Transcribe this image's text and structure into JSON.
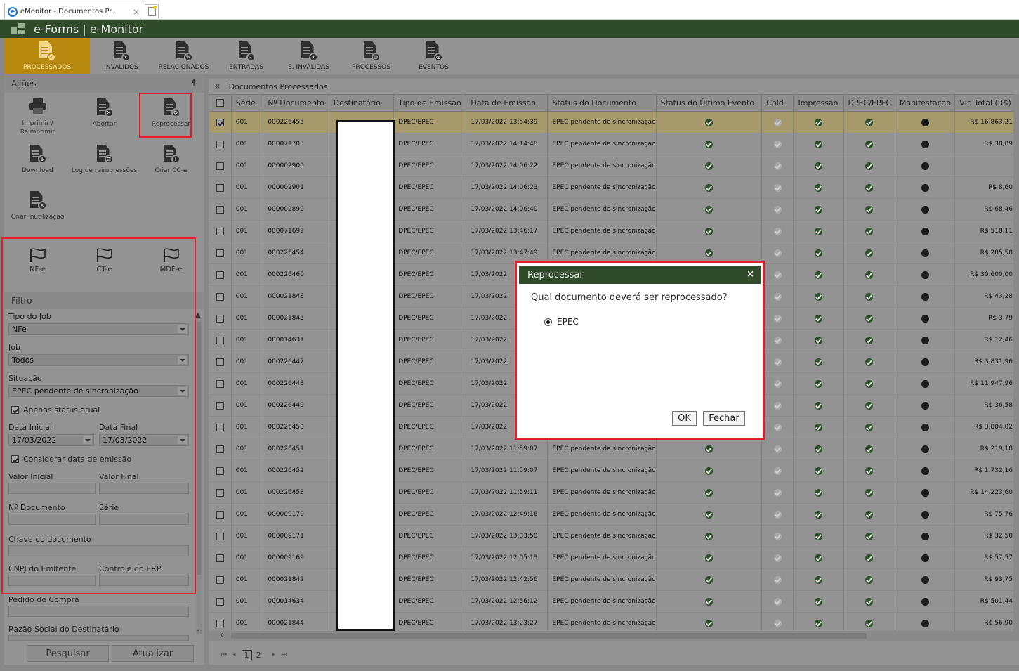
{
  "browser": {
    "tab_title": "eMonitor - Documentos Pr...",
    "tab_close": "×"
  },
  "app": {
    "title": "e-Forms | e-Monitor"
  },
  "toolbar": {
    "items": [
      {
        "label": "PROCESSADOS",
        "icon": "document-check-icon",
        "badge": "✓",
        "active": true
      },
      {
        "label": "INVÁLIDOS",
        "icon": "document-x-icon",
        "badge": "✕"
      },
      {
        "label": "RELACIONADOS",
        "icon": "document-edit-icon",
        "badge": "✎"
      },
      {
        "label": "ENTRADAS",
        "icon": "document-check-icon",
        "badge": "✓"
      },
      {
        "label": "E. INVÁLIDAS",
        "icon": "document-x-icon",
        "badge": "✕"
      },
      {
        "label": "PROCESSOS",
        "icon": "document-gear-icon",
        "badge": "⚙"
      },
      {
        "label": "EVENTOS",
        "icon": "document-event-icon",
        "badge": "⊘"
      }
    ]
  },
  "actions": {
    "title": "Ações",
    "items": [
      {
        "label": "Imprimir / Reimprimir",
        "icon": "printer-icon"
      },
      {
        "label": "Abortar",
        "icon": "document-x-icon",
        "badge": "✕"
      },
      {
        "label": "Reprocessar",
        "icon": "document-refresh-icon",
        "badge": "↻",
        "highlighted": true
      },
      {
        "label": "Download",
        "icon": "document-download-icon",
        "badge": "↓"
      },
      {
        "label": "Log de reimpressões",
        "icon": "document-list-icon",
        "badge": "≡"
      },
      {
        "label": "Criar CC-e",
        "icon": "document-add-icon",
        "badge": "+"
      },
      {
        "label": "Criar inutilização",
        "icon": "document-x-icon",
        "badge": "✕"
      }
    ],
    "flags": [
      {
        "label": "NF-e",
        "icon": "flag-icon"
      },
      {
        "label": "CT-e",
        "icon": "flag-icon"
      },
      {
        "label": "MDF-e",
        "icon": "flag-icon"
      }
    ]
  },
  "filter": {
    "title": "Filtro",
    "tipo_job_label": "Tipo do Job",
    "tipo_job_value": "NFe",
    "job_label": "Job",
    "job_value": "Todos",
    "situacao_label": "Situação",
    "situacao_value": "EPEC pendente de sincronização",
    "apenas_status": "Apenas status atual",
    "data_inicial_label": "Data Inicial",
    "data_inicial_value": "17/03/2022",
    "data_final_label": "Data Final",
    "data_final_value": "17/03/2022",
    "considerar_data": "Considerar data de emissão",
    "valor_inicial_label": "Valor Inicial",
    "valor_final_label": "Valor Final",
    "numero_doc_label": "Nº Documento",
    "serie_label": "Série",
    "chave_label": "Chave do documento",
    "cnpj_label": "CNPJ do Emitente",
    "controle_label": "Controle do ERP",
    "pedido_label": "Pedido de Compra",
    "razao_label": "Razão Social do Destinatário",
    "pesquisar": "Pesquisar",
    "atualizar": "Atualizar"
  },
  "grid": {
    "title": "Documentos Processados",
    "columns": [
      "Série",
      "Nº Documento",
      "Destinatário",
      "Tipo de Emissão",
      "Data de Emissão",
      "Status do Documento",
      "Status do Último Evento",
      "Cold",
      "Impressão",
      "DPEC/EPEC",
      "Manifestação",
      "Vlr. Total (R$)"
    ],
    "rows": [
      {
        "serie": "001",
        "numero": "000226455",
        "tipo": "DPEC/EPEC",
        "data": "17/03/2022 13:54:39",
        "status": "EPEC pendente de sincronização",
        "valor": "R$ 16.863,21",
        "checked": true
      },
      {
        "serie": "001",
        "numero": "000071703",
        "tipo": "DPEC/EPEC",
        "data": "17/03/2022 14:14:48",
        "status": "EPEC pendente de sincronização",
        "valor": "R$ 38,89"
      },
      {
        "serie": "001",
        "numero": "000002900",
        "tipo": "DPEC/EPEC",
        "data": "17/03/2022 14:06:22",
        "status": "EPEC pendente de sincronização",
        "valor": ""
      },
      {
        "serie": "001",
        "numero": "000002901",
        "tipo": "DPEC/EPEC",
        "data": "17/03/2022 14:06:23",
        "status": "EPEC pendente de sincronização",
        "valor": "R$ 8,60"
      },
      {
        "serie": "001",
        "numero": "000002899",
        "tipo": "DPEC/EPEC",
        "data": "17/03/2022 14:06:40",
        "status": "EPEC pendente de sincronização",
        "valor": "R$ 68,46"
      },
      {
        "serie": "001",
        "numero": "000071699",
        "tipo": "DPEC/EPEC",
        "data": "17/03/2022 13:46:17",
        "status": "EPEC pendente de sincronização",
        "valor": "R$ 518,11"
      },
      {
        "serie": "001",
        "numero": "000226454",
        "tipo": "DPEC/EPEC",
        "data": "17/03/2022 13:47:49",
        "status": "EPEC pendente de sincronização",
        "valor": "R$ 285,58"
      },
      {
        "serie": "001",
        "numero": "000226460",
        "tipo": "DPEC/EPEC",
        "data": "17/03/2022",
        "status": "",
        "valor": "R$ 30.600,00"
      },
      {
        "serie": "001",
        "numero": "000021843",
        "tipo": "DPEC/EPEC",
        "data": "17/03/2022",
        "status": "",
        "valor": "R$ 43,28"
      },
      {
        "serie": "001",
        "numero": "000021845",
        "tipo": "DPEC/EPEC",
        "data": "17/03/2022",
        "status": "",
        "valor": "R$ 3,79"
      },
      {
        "serie": "001",
        "numero": "000014631",
        "tipo": "DPEC/EPEC",
        "data": "17/03/2022",
        "status": "",
        "valor": "R$ 12,46"
      },
      {
        "serie": "001",
        "numero": "000226447",
        "tipo": "DPEC/EPEC",
        "data": "17/03/2022",
        "status": "",
        "valor": "R$ 3.831,96"
      },
      {
        "serie": "001",
        "numero": "000226448",
        "tipo": "DPEC/EPEC",
        "data": "17/03/2022",
        "status": "",
        "valor": "R$ 11.947,96"
      },
      {
        "serie": "001",
        "numero": "000226449",
        "tipo": "DPEC/EPEC",
        "data": "17/03/2022",
        "status": "",
        "valor": "R$ 36,58"
      },
      {
        "serie": "001",
        "numero": "000226450",
        "tipo": "DPEC/EPEC",
        "data": "17/03/2022",
        "status": "",
        "valor": "R$ 3.804,02"
      },
      {
        "serie": "001",
        "numero": "000226451",
        "tipo": "DPEC/EPEC",
        "data": "17/03/2022 11:59:07",
        "status": "EPEC pendente de sincronização",
        "valor": "R$ 219,18"
      },
      {
        "serie": "001",
        "numero": "000226452",
        "tipo": "DPEC/EPEC",
        "data": "17/03/2022 11:59:07",
        "status": "EPEC pendente de sincronização",
        "valor": "R$ 1.732,16"
      },
      {
        "serie": "001",
        "numero": "000226453",
        "tipo": "DPEC/EPEC",
        "data": "17/03/2022 11:59:11",
        "status": "EPEC pendente de sincronização",
        "valor": "R$ 14.223,60"
      },
      {
        "serie": "001",
        "numero": "000009170",
        "tipo": "DPEC/EPEC",
        "data": "17/03/2022 12:49:16",
        "status": "EPEC pendente de sincronização",
        "valor": "R$ 75,76"
      },
      {
        "serie": "001",
        "numero": "000009171",
        "tipo": "DPEC/EPEC",
        "data": "17/03/2022 13:33:50",
        "status": "EPEC pendente de sincronização",
        "valor": "R$ 32,50"
      },
      {
        "serie": "001",
        "numero": "000009169",
        "tipo": "DPEC/EPEC",
        "data": "17/03/2022 12:05:13",
        "status": "EPEC pendente de sincronização",
        "valor": "R$ 57,57"
      },
      {
        "serie": "001",
        "numero": "000021842",
        "tipo": "DPEC/EPEC",
        "data": "17/03/2022 12:42:56",
        "status": "EPEC pendente de sincronização",
        "valor": "R$ 93,75"
      },
      {
        "serie": "001",
        "numero": "000014634",
        "tipo": "DPEC/EPEC",
        "data": "17/03/2022 12:56:12",
        "status": "EPEC pendente de sincronização",
        "valor": "R$ 501,44"
      },
      {
        "serie": "001",
        "numero": "000021844",
        "tipo": "DPEC/EPEC",
        "data": "17/03/2022 13:23:27",
        "status": "EPEC pendente de sincronização",
        "valor": "R$ 56,90"
      }
    ],
    "pages": [
      "1",
      "2"
    ]
  },
  "modal": {
    "title": "Reprocessar",
    "close": "×",
    "question": "Qual documento deverá ser reprocessado?",
    "option": "EPEC",
    "ok": "OK",
    "fechar": "Fechar"
  }
}
